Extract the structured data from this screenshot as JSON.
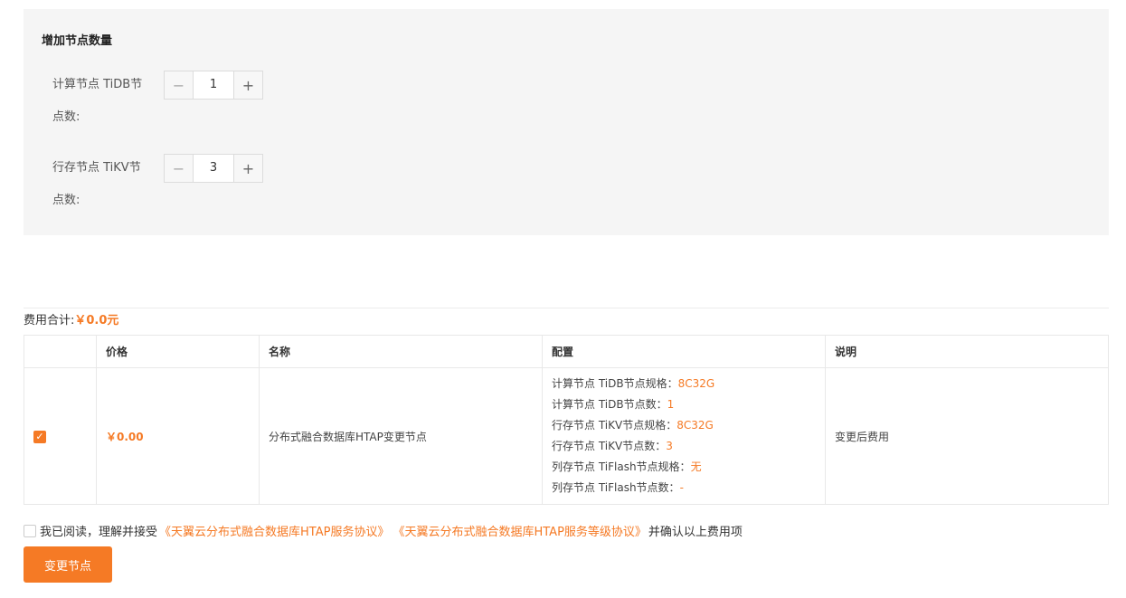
{
  "panel": {
    "title": "增加节点数量",
    "tidb": {
      "label_line1": "计算节点 TiDB节",
      "label_line2": "点数:",
      "value": "1"
    },
    "tikv": {
      "label_line1": "行存节点 TiKV节",
      "label_line2": "点数:",
      "value": "3"
    },
    "minus_symbol": "−",
    "plus_symbol": "+"
  },
  "total": {
    "label": "费用合计:",
    "amount": "￥0.0元"
  },
  "table": {
    "headers": [
      "",
      "价格",
      "名称",
      "配置",
      "说明"
    ],
    "row": {
      "checked": true,
      "check_mark": "✓",
      "price": "￥0.00",
      "name": "分布式融合数据库HTAP变更节点",
      "config": [
        {
          "label": "计算节点 TiDB节点规格：",
          "value": "8C32G"
        },
        {
          "label": "计算节点 TiDB节点数：",
          "value": "1"
        },
        {
          "label": "行存节点 TiKV节点规格：",
          "value": "8C32G"
        },
        {
          "label": "行存节点 TiKV节点数：",
          "value": "3"
        },
        {
          "label": "列存节点 TiFlash节点规格：",
          "value": "无"
        },
        {
          "label": "列存节点 TiFlash节点数：",
          "value": "-"
        }
      ],
      "note": "变更后费用"
    }
  },
  "agreement": {
    "prefix": "我已阅读，理解并接受",
    "link1": "《天翼云分布式融合数据库HTAP服务协议》",
    "link2": "《天翼云分布式融合数据库HTAP服务等级协议》",
    "suffix": "并确认以上费用项"
  },
  "submit_label": "变更节点",
  "colors": {
    "accent": "#f57a25",
    "panel_bg": "#f5f5f5"
  }
}
